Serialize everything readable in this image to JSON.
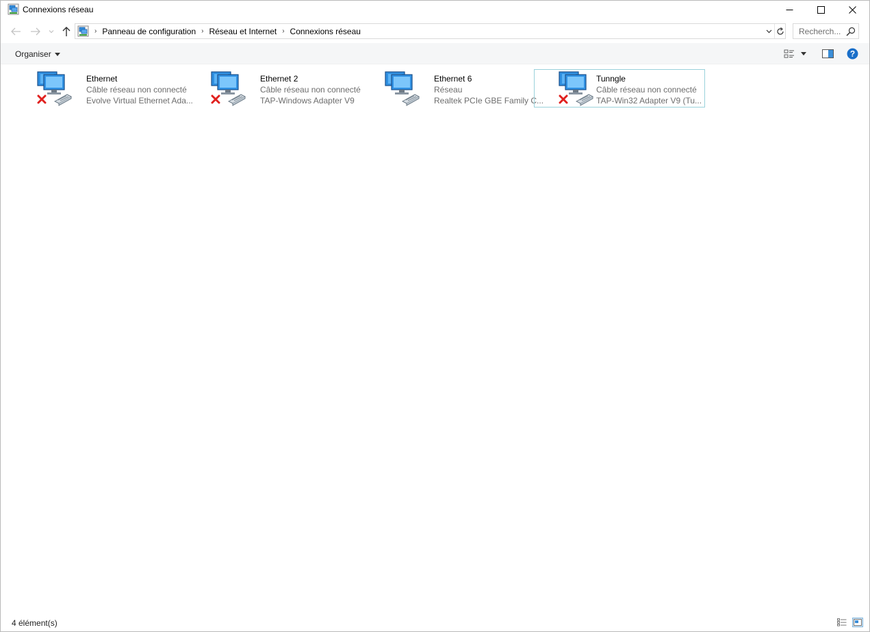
{
  "window": {
    "title": "Connexions réseau"
  },
  "nav": {
    "breadcrumbs": [
      "Panneau de configuration",
      "Réseau et Internet",
      "Connexions réseau"
    ],
    "search_placeholder": "Recherch..."
  },
  "command_bar": {
    "organise_label": "Organiser"
  },
  "connections": [
    {
      "name": "Ethernet",
      "status": "Câble réseau non connecté",
      "device": "Evolve Virtual Ethernet Ada...",
      "disconnected": true,
      "selected": false
    },
    {
      "name": "Ethernet 2",
      "status": "Câble réseau non connecté",
      "device": "TAP-Windows Adapter V9",
      "disconnected": true,
      "selected": false
    },
    {
      "name": "Ethernet 6",
      "status": "Réseau",
      "device": "Realtek PCIe GBE Family C...",
      "disconnected": false,
      "selected": false
    },
    {
      "name": "Tunngle",
      "status": "Câble réseau non connecté",
      "device": "TAP-Win32 Adapter V9 (Tu...",
      "disconnected": true,
      "selected": true
    }
  ],
  "status_bar": {
    "item_count": "4 élément(s)"
  },
  "colors": {
    "selection_border": "#99d1db",
    "help_blue": "#1a6fc9",
    "disconnect_red": "#e0201e",
    "monitor_blue": "#2f8fe0"
  }
}
